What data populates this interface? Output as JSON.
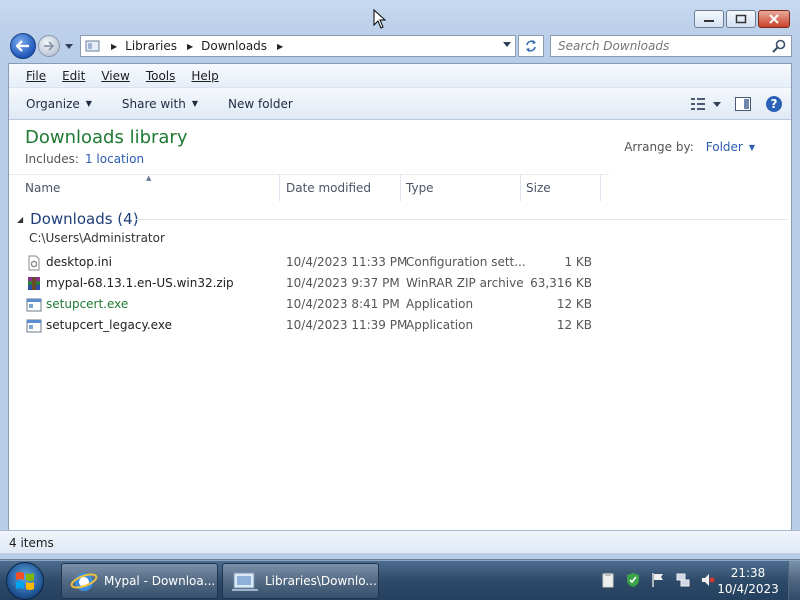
{
  "window": {
    "controls": [
      "minimize",
      "maximize",
      "close"
    ]
  },
  "address": {
    "crumbs": [
      "Libraries",
      "Downloads"
    ],
    "search_placeholder": "Search Downloads"
  },
  "menu": [
    "File",
    "Edit",
    "View",
    "Tools",
    "Help"
  ],
  "toolbar": {
    "organize": "Organize",
    "share_with": "Share with",
    "new_folder": "New folder"
  },
  "library": {
    "title": "Downloads library",
    "includes_label": "Includes:",
    "includes_link": "1 location",
    "arrange_label": "Arrange by:",
    "arrange_value": "Folder"
  },
  "columns": {
    "name": "Name",
    "date": "Date modified",
    "type": "Type",
    "size": "Size"
  },
  "group": {
    "title": "Downloads (4)",
    "path": "C:\\Users\\Administrator"
  },
  "files": [
    {
      "name": "desktop.ini",
      "date": "10/4/2023 11:33 PM",
      "type": "Configuration sett...",
      "size": "1 KB",
      "icon": "config-file-icon"
    },
    {
      "name": "mypal-68.13.1.en-US.win32.zip",
      "date": "10/4/2023 9:37 PM",
      "type": "WinRAR ZIP archive",
      "size": "63,316 KB",
      "icon": "winrar-archive-icon"
    },
    {
      "name": "setupcert.exe",
      "date": "10/4/2023 8:41 PM",
      "type": "Application",
      "size": "12 KB",
      "icon": "application-icon"
    },
    {
      "name": "setupcert_legacy.exe",
      "date": "10/4/2023 11:39 PM",
      "type": "Application",
      "size": "12 KB",
      "icon": "application-icon"
    }
  ],
  "status": {
    "items": "4 items"
  },
  "taskbar": {
    "buttons": [
      "Mypal - Downloa...",
      "Libraries\\Downlo..."
    ],
    "time": "21:38",
    "date": "10/4/2023"
  },
  "colors": {
    "library_title": "#1e7a33",
    "link": "#2a5db0",
    "highlight_name": "#1e7a33"
  }
}
